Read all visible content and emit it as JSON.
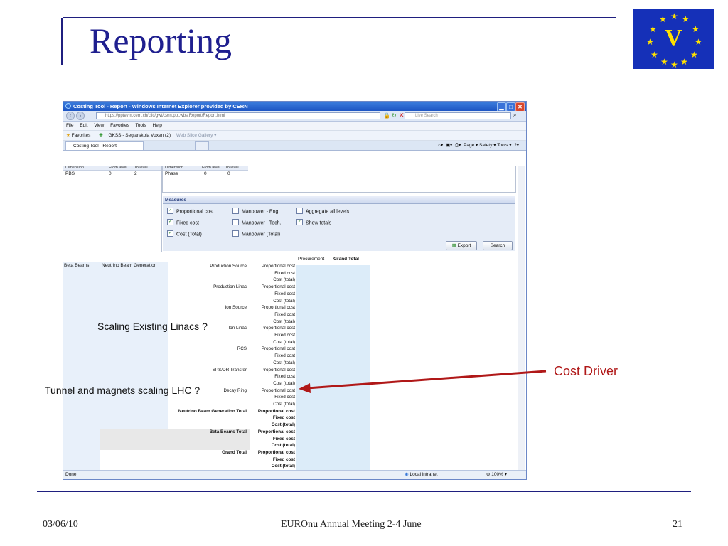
{
  "slide": {
    "title": "Reporting",
    "logo_letter": "V",
    "footer_date": "03/06/10",
    "footer_center": "EUROnu Annual Meeting 2-4  June",
    "footer_page": "21"
  },
  "browser": {
    "window_title": "Costing Tool - Report - Windows Internet Explorer provided by CERN",
    "address": "https://pptevm.cern.ch/clic/gwt/cern.ppt.wbs.Report/Report.html",
    "live_search_placeholder": "Live Search",
    "menu": [
      "File",
      "Edit",
      "View",
      "Favorites",
      "Tools",
      "Help"
    ],
    "favorites_label": "Favorites",
    "favorites_links": [
      "GKSS - Seglarskola Vuxen (2)",
      "Web Slice Gallery ▾"
    ],
    "tab_label": "Costing Tool - Report",
    "command_bar": "Page ▾   Safety ▾   Tools ▾",
    "status_left": "Done",
    "status_zone": "Local intranet",
    "status_zoom": "100%"
  },
  "dimensions": {
    "left_headers": [
      "Dimension",
      "From level",
      "To level"
    ],
    "left_row": [
      "PBS",
      "0",
      "2"
    ],
    "right_headers": [
      "Dimension",
      "From level",
      "To level"
    ],
    "right_row": [
      "Phase",
      "0",
      "0"
    ]
  },
  "measures": {
    "title": "Measures",
    "checkboxes": [
      {
        "label": "Proportional cost",
        "checked": true
      },
      {
        "label": "Manpower - Eng.",
        "checked": false
      },
      {
        "label": "Aggregate all levels",
        "checked": false
      },
      {
        "label": "Fixed cost",
        "checked": true
      },
      {
        "label": "Manpower - Tech.",
        "checked": false
      },
      {
        "label": "Show totals",
        "checked": true
      },
      {
        "label": "Cost (Total)",
        "checked": true
      },
      {
        "label": "Manpower (Total)",
        "checked": false
      }
    ],
    "export_label": "Export",
    "search_label": "Search"
  },
  "report": {
    "col_procurement": "Procurement",
    "col_grand_total": "Grand Total",
    "level1": "Beta Beams",
    "level2": "Neutrino Beam Generation",
    "items": [
      "Production Source",
      "Production Linac",
      "Ion Source",
      "Ion Linac",
      "RCS",
      "SPS/DR Transfer",
      "Decay Ring"
    ],
    "measure_rows": [
      "Proportional cost",
      "Fixed cost",
      "Cost (total)"
    ],
    "total_nbg": "Neutrino Beam Generation Total",
    "total_bb": "Beta Beams Total",
    "total_grand": "Grand Total"
  },
  "annotations": {
    "scaling_linacs": "Scaling Existing Linacs ?",
    "tunnel_magnets": "Tunnel and magnets scaling LHC ?",
    "cost_driver": "Cost Driver"
  },
  "colors": {
    "title_blue": "#1f1f8f",
    "arrow_red": "#b01818",
    "flag_blue": "#1530b8",
    "flag_yellow": "#ffe100"
  }
}
